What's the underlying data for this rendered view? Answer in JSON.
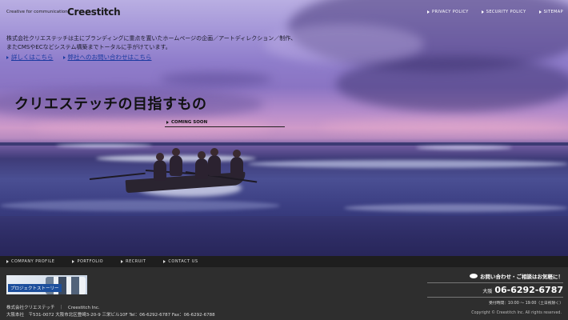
{
  "header": {
    "tagline": "Creative for communication",
    "logo": "Creestitch",
    "nav": [
      "PRIVACY POLICY",
      "SECURITY POLICY",
      "SITEMAP"
    ]
  },
  "intro": {
    "line1": "株式会社クリエステッチは主にブランディングに重点を置いたホームページの企画／アートディレクション／制作、",
    "line2": "またCMSやECなどシステム構築までトータルに手がけています。",
    "link1": "詳しくはこちら",
    "link2": "弊社へのお問い合わせはこちら"
  },
  "hero": {
    "headline": "クリエステッチの目指すもの",
    "coming": "COMING SOON"
  },
  "footer_nav": [
    "COMPANY PROFILE",
    "PORTFOLIO",
    "RECRUIT",
    "CONTACT US"
  ],
  "footer": {
    "banner_label": "プロジェクトストーリー",
    "contact_head": "お問い合わせ・ご相談はお気軽に！",
    "phone_city": "大阪",
    "phone_number": "06-6292-6787",
    "hours": "受付時間：10:00 〜 19:00（土日祝除く）",
    "company": "株式会社クリエステッチ　｜　Creestitch Inc.",
    "address": "大阪本社　〒531-0072 大阪市北区豊崎3-20-9 三栄ビル10F  Tel：06-6292-6787  Fax：06-6292-6788",
    "copyright": "Copyright © Creestitch Inc. All rights reserved."
  },
  "colors": {
    "accent_link": "#1a3aa0",
    "footer_bg": "#2e2e2e",
    "footer_nav_bg": "#1e1e1e",
    "banner_label_bg": "#1d4f9c"
  },
  "icons": [
    "arrow-right-icon",
    "chat-bubble-icon"
  ]
}
